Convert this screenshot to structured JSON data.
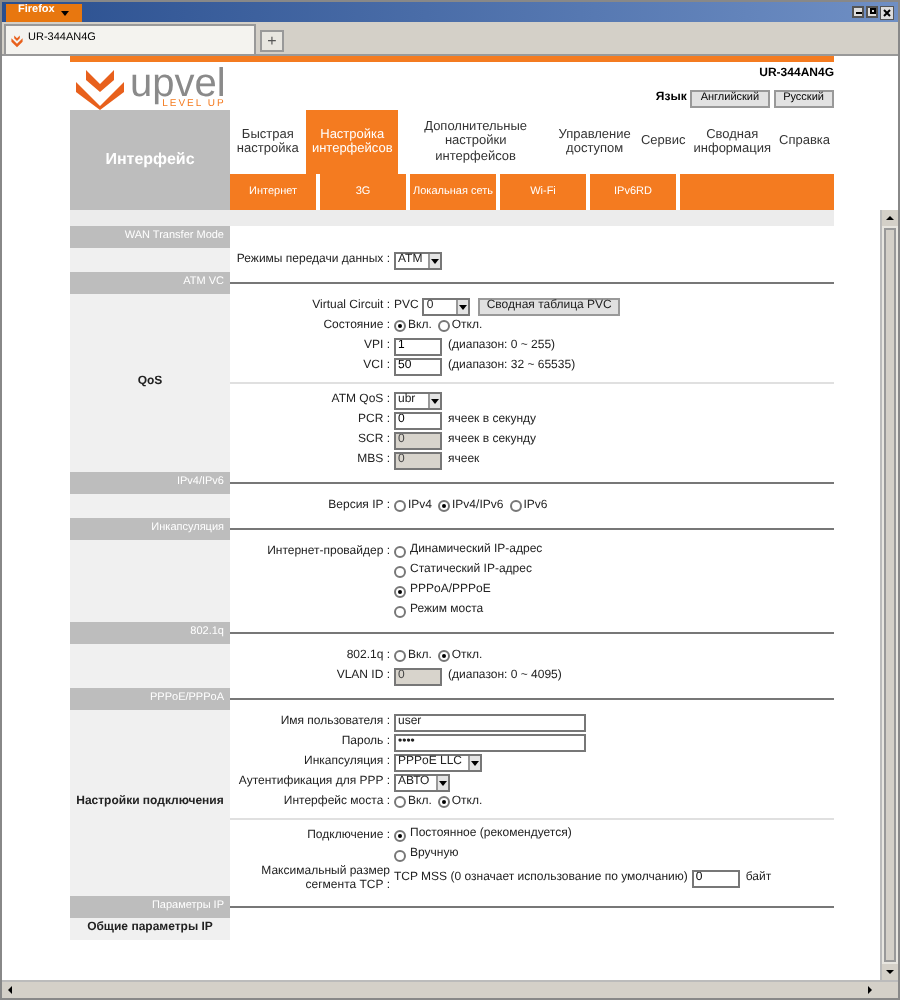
{
  "browser": {
    "menu_button": "Firefox",
    "tab_title": "UR-344AN4G",
    "new_tab": "+"
  },
  "header": {
    "logo": "upvel",
    "tagline": "LEVEL UP",
    "model": "UR-344AN4G",
    "language_label": "Язык",
    "languages": [
      "Английский",
      "Русский"
    ]
  },
  "sidebar_title": "Интерфейс",
  "nav": [
    {
      "label": "Быстрая настройка",
      "selected": false
    },
    {
      "label": "Настройка интерфейсов",
      "selected": true
    },
    {
      "label": "Дополнительные настройки интерфейсов",
      "selected": false
    },
    {
      "label": "Управление доступом",
      "selected": false
    },
    {
      "label": "Сервис",
      "selected": false
    },
    {
      "label": "Сводная информация",
      "selected": false
    },
    {
      "label": "Справка",
      "selected": false
    }
  ],
  "subnav": [
    "Интернет",
    "3G",
    "Локальная сеть",
    "Wi-Fi",
    "IPv6RD"
  ],
  "sections": [
    {
      "title": "WAN Transfer Mode",
      "rows": [
        {
          "kind": "select",
          "label": "Режимы передачи данных :",
          "value": "ATM"
        }
      ]
    },
    {
      "title": "ATM VC",
      "side_label": "QoS",
      "rows": [
        {
          "kind": "select",
          "label": "Virtual Circuit :",
          "prefix": "PVC",
          "value": "0",
          "button": "Сводная таблица PVC"
        },
        {
          "kind": "radios",
          "label": "Состояние :",
          "options": [
            {
              "label": "Вкл.",
              "selected": true
            },
            {
              "label": "Откл.",
              "selected": false
            }
          ]
        },
        {
          "kind": "number",
          "label": "VPI :",
          "value": "1",
          "disabled": false,
          "note": "(диапазон: 0 ~ 255)"
        },
        {
          "kind": "number",
          "label": "VCI :",
          "value": "50",
          "disabled": false,
          "note": "(диапазон: 32 ~ 65535)"
        },
        {
          "kind": "divider"
        },
        {
          "kind": "select",
          "label": "ATM QoS :",
          "value": "ubr"
        },
        {
          "kind": "number",
          "label": "PCR :",
          "value": "0",
          "disabled": false,
          "note": "ячеек в секунду"
        },
        {
          "kind": "number",
          "label": "SCR :",
          "value": "0",
          "disabled": true,
          "note": "ячеек в секунду"
        },
        {
          "kind": "number",
          "label": "MBS :",
          "value": "0",
          "disabled": true,
          "note": "ячеек"
        }
      ]
    },
    {
      "title": "IPv4/IPv6",
      "rows": [
        {
          "kind": "radios",
          "label": "Версия IP :",
          "options": [
            {
              "label": "IPv4",
              "selected": false
            },
            {
              "label": "IPv4/IPv6",
              "selected": true
            },
            {
              "label": "IPv6",
              "selected": false
            }
          ]
        }
      ]
    },
    {
      "title": "Инкапсуляция",
      "rows": [
        {
          "kind": "radio-list",
          "label": "Интернет-провайдер :",
          "options": [
            {
              "label": "Динамический IP-адрес",
              "selected": false
            },
            {
              "label": "Статический IP-адрес",
              "selected": false
            },
            {
              "label": "PPPoA/PPPoE",
              "selected": true
            },
            {
              "label": "Режим моста",
              "selected": false
            }
          ]
        }
      ]
    },
    {
      "title": "802.1q",
      "rows": [
        {
          "kind": "radios",
          "label": "802.1q :",
          "options": [
            {
              "label": "Вкл.",
              "selected": false
            },
            {
              "label": "Откл.",
              "selected": true
            }
          ]
        },
        {
          "kind": "number",
          "label": "VLAN ID :",
          "value": "0",
          "disabled": true,
          "note": "(диапазон: 0 ~ 4095)"
        }
      ]
    },
    {
      "title": "PPPoE/PPPoA",
      "side_label": "Настройки подключения",
      "rows": [
        {
          "kind": "text",
          "label": "Имя пользователя :",
          "value": "user"
        },
        {
          "kind": "text",
          "label": "Пароль :",
          "value": "••••"
        },
        {
          "kind": "select",
          "label": "Инкапсуляция :",
          "value": "PPPoE LLC"
        },
        {
          "kind": "select",
          "label": "Аутентификация для PPP :",
          "value": "АВТО"
        },
        {
          "kind": "radios",
          "label": "Интерфейс моста :",
          "options": [
            {
              "label": "Вкл.",
              "selected": false
            },
            {
              "label": "Откл.",
              "selected": true
            }
          ]
        },
        {
          "kind": "divider"
        },
        {
          "kind": "radio-list",
          "label": "Подключение :",
          "options": [
            {
              "label": "Постоянное (рекомендуется)",
              "selected": true
            },
            {
              "label": "Вручную",
              "selected": false
            }
          ]
        },
        {
          "kind": "number",
          "label": "Максимальный размер сегмента TCP :",
          "prefix": "TCP MSS (0 означает использование по умолчанию)",
          "value": "0",
          "disabled": false,
          "note": "байт"
        }
      ]
    },
    {
      "title": "Параметры IP",
      "side_label": "Общие параметры IP"
    }
  ]
}
